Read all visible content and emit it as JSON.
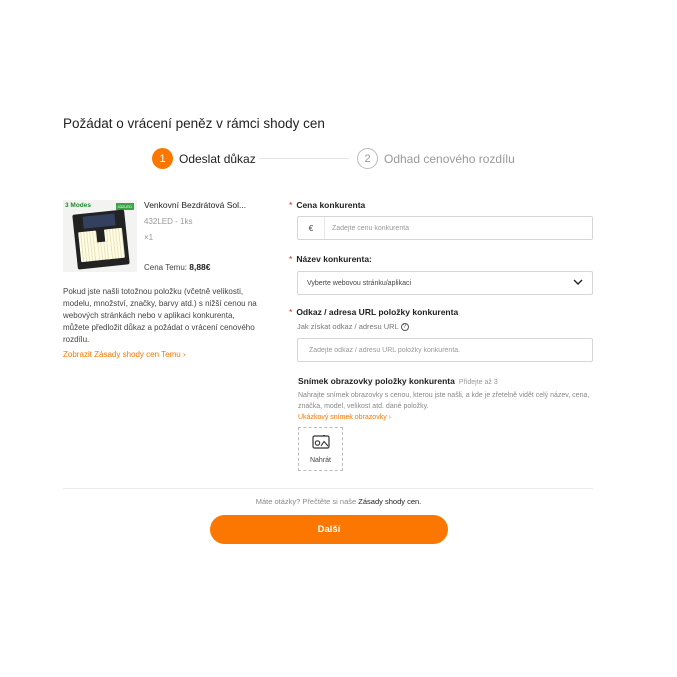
{
  "page": {
    "title": "Požádat o vrácení peněz v rámci shody cen"
  },
  "steps": [
    {
      "number": "1",
      "label": "Odeslat důkaz"
    },
    {
      "number": "2",
      "label": "Odhad cenového rozdílu"
    }
  ],
  "product": {
    "image_badge": "3 Modes",
    "image_tag": "432LED",
    "name": "Venkovní Bezdrátová Sol...",
    "spec": "432LED - 1ks",
    "qty": "×1",
    "price_label": "Cena Temu:",
    "price_value": "8,88€"
  },
  "description": "Pokud jste našli totožnou položku (včetně velikosti, modelu, množství, značky, barvy atd.) s nižší cenou na webových stránkách nebo v aplikaci konkurenta, můžete předložit důkaz a požádat o vrácení cenového rozdílu.",
  "policy_link": "Zobrazit Zásady shody cen Temu ›",
  "form": {
    "required_mark": "*",
    "price": {
      "label": "Cena konkurenta",
      "currency": "€",
      "placeholder": "Zadejte cenu konkurenta"
    },
    "competitor": {
      "label": "Název konkurenta:",
      "placeholder": "Vyberte webovou stránku/aplikaci"
    },
    "url": {
      "label": "Odkaz / adresa URL položky konkurenta",
      "help": "Jak získat odkaz / adresu URL",
      "placeholder": "Zadejte odkaz / adresu URL položky konkurenta."
    },
    "screenshot": {
      "label": "Snímek obrazovky položky konkurenta",
      "limit": "Přidejte až 3",
      "description": "Nahrajte snímek obrazovky s cenou, kterou jste našli, a kde je zřetelně vidět celý název, cena, značka, model, velikost atd. dané položky.",
      "example_link": "Ukázkový snímek obrazovky ›",
      "upload_label": "Nahrát"
    }
  },
  "footer": {
    "question": "Máte otázky? Přečtěte si naše",
    "link": "Zásady shody cen."
  },
  "next_button": "Další",
  "colors": {
    "accent": "#fb7701",
    "required": "#e02020",
    "divider": "#ececec"
  }
}
